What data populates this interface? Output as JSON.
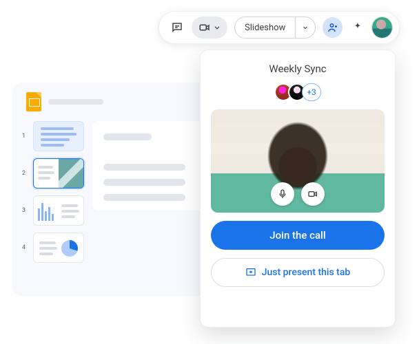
{
  "toolbar": {
    "slideshow_label": "Slideshow"
  },
  "slides": {
    "thumbs": [
      {
        "num": "1"
      },
      {
        "num": "2"
      },
      {
        "num": "3"
      },
      {
        "num": "4"
      }
    ]
  },
  "meet": {
    "title": "Weekly Sync",
    "more_participants": "+3",
    "join_label": "Join the call",
    "present_label": "Just present this tab"
  }
}
